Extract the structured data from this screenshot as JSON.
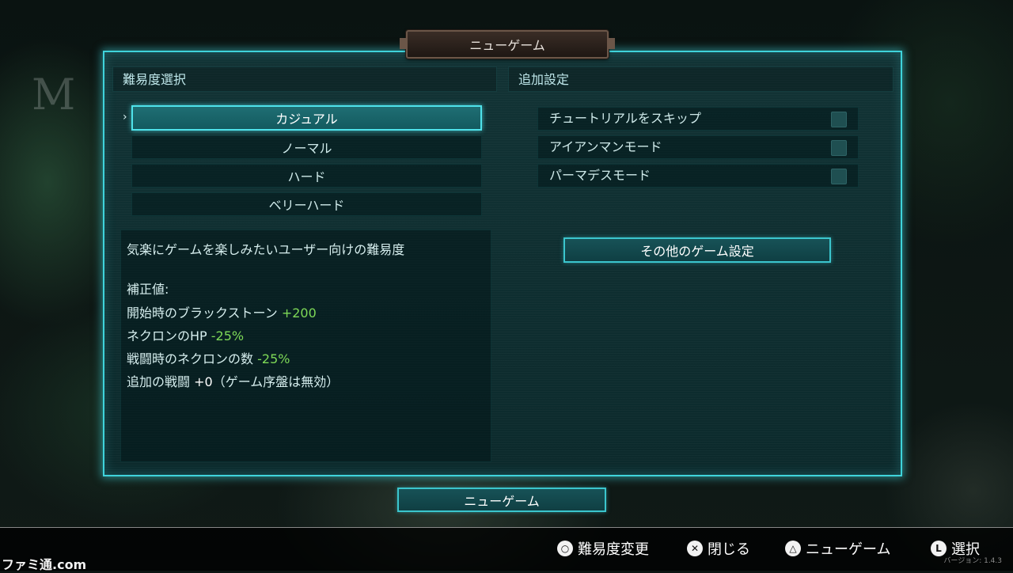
{
  "window": {
    "title": "ニューゲーム"
  },
  "background": {
    "logo_text": "M"
  },
  "difficulty": {
    "header": "難易度選択",
    "options": [
      "カジュアル",
      "ノーマル",
      "ハード",
      "ベリーハード"
    ],
    "selected_index": 0,
    "description": "気楽にゲームを楽しみたいユーザー向けの難易度",
    "modifiers_label": "補正値:",
    "modifiers": [
      {
        "label": "開始時のブラックストーン",
        "value": "+200"
      },
      {
        "label": "ネクロンのHP",
        "value": "-25%"
      },
      {
        "label": "戦闘時のネクロンの数",
        "value": "-25%"
      },
      {
        "label": "追加の戦闘",
        "value": "+0",
        "suffix": "（ゲーム序盤は無効）"
      }
    ]
  },
  "additional": {
    "header": "追加設定",
    "options": [
      {
        "label": "チュートリアルをスキップ",
        "checked": false
      },
      {
        "label": "アイアンマンモード",
        "checked": false
      },
      {
        "label": "パーマデスモード",
        "checked": false
      }
    ],
    "other_settings_label": "その他のゲーム設定"
  },
  "start_button": "ニューゲーム",
  "footer": {
    "hints": [
      {
        "icon": "circle-button-icon",
        "glyph": "○",
        "label": "難易度変更"
      },
      {
        "icon": "cross-button-icon",
        "glyph": "✕",
        "label": "閉じる"
      },
      {
        "icon": "triangle-button-icon",
        "glyph": "△",
        "label": "ニューゲーム"
      },
      {
        "icon": "left-stick-icon",
        "glyph": "L",
        "label": "選択"
      }
    ],
    "version": "バージョン: 1.4.3"
  },
  "watermark": "ファミ通.com",
  "colors": {
    "accent": "#3fd3db",
    "positive": "#7ed957"
  }
}
